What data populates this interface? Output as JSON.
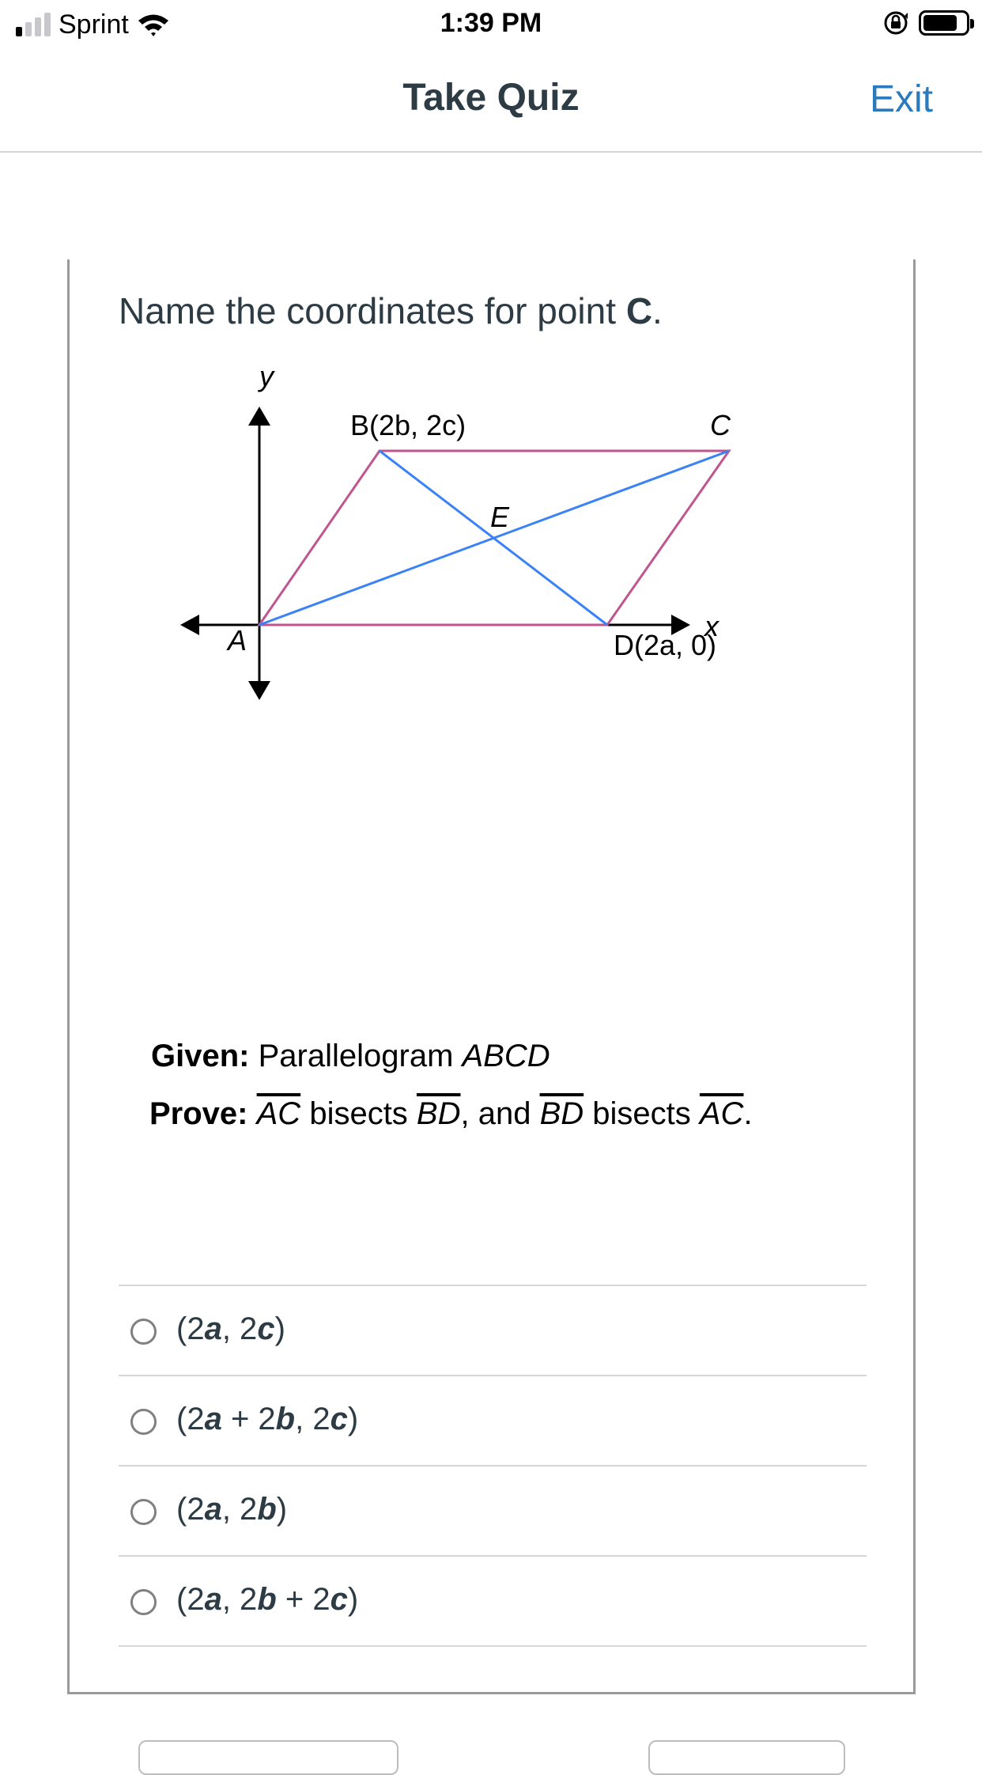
{
  "status_bar": {
    "carrier": "Sprint",
    "time": "1:39 PM",
    "signal_bars_on": 1,
    "signal_bars_total": 4
  },
  "nav": {
    "title": "Take Quiz",
    "exit_label": "Exit"
  },
  "question": {
    "prompt_prefix": "Name the coordinates for point ",
    "prompt_point": "C",
    "prompt_suffix": "."
  },
  "diagram": {
    "y_axis_label": "y",
    "x_axis_label": "x",
    "label_A": "A",
    "label_B": "B(2b, 2c)",
    "label_C": "C",
    "label_D": "D(2a, 0)",
    "label_E": "E",
    "parallelogram_color": "#c0558f",
    "diagonal_color": "#3b82f6"
  },
  "given": {
    "heading": "Given:",
    "text_prefix": "Parallelogram ",
    "shape_name": "ABCD"
  },
  "prove": {
    "heading": "Prove:",
    "seg1": "AC",
    "mid1": " bisects ",
    "seg2": "BD",
    "mid2": ", and ",
    "seg3": "BD",
    "mid3": " bisects ",
    "seg4": "AC",
    "end": "."
  },
  "choices": [
    {
      "p1": "(2",
      "v1": "a",
      "p2": ", 2",
      "v2": "c",
      "p3": ")",
      "v3": "",
      "p4": "",
      "v4": "",
      "p5": ""
    },
    {
      "p1": "(2",
      "v1": "a",
      "p2": " + 2",
      "v2": "b",
      "p3": ", 2",
      "v3": "c",
      "p4": ")",
      "v4": "",
      "p5": ""
    },
    {
      "p1": "(2",
      "v1": "a",
      "p2": ", 2",
      "v2": "b",
      "p3": ")",
      "v3": "",
      "p4": "",
      "v4": "",
      "p5": ""
    },
    {
      "p1": "(2",
      "v1": "a",
      "p2": ", 2",
      "v2": "b",
      "p3": " + 2",
      "v3": "c",
      "p4": ")",
      "v4": "",
      "p5": ""
    }
  ]
}
